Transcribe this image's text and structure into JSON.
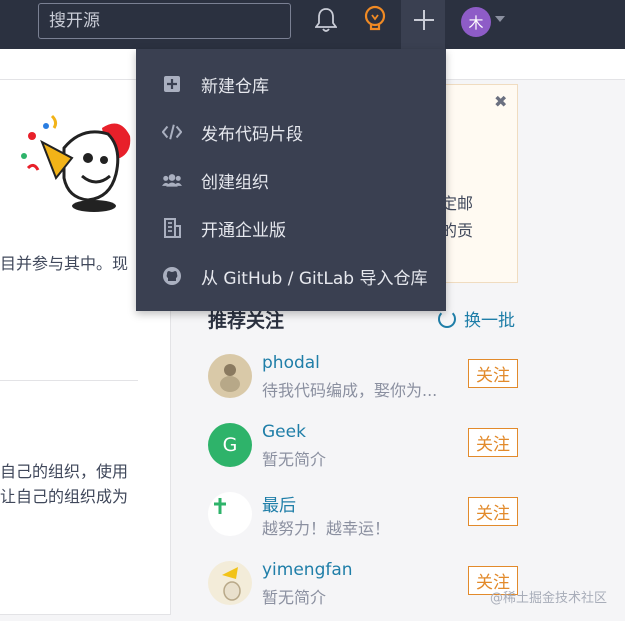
{
  "topbar": {
    "search_placeholder": "搜开源",
    "avatar_letter": "木"
  },
  "dropdown": {
    "items": [
      {
        "label": "新建仓库",
        "icon": "plus-square-icon"
      },
      {
        "label": "发布代码片段",
        "icon": "code-icon"
      },
      {
        "label": "创建组织",
        "icon": "users-icon"
      },
      {
        "label": "开通企业版",
        "icon": "building-icon"
      },
      {
        "label": "从 GitHub / GitLab 导入仓库",
        "icon": "github-icon"
      }
    ]
  },
  "left": {
    "line1": "目并参与其中。现",
    "line2": "自己的组织，使用",
    "line3": "让自己的组织成为"
  },
  "notice": {
    "line1": "绑定邮",
    "line2": "上的贡",
    "close": "✖"
  },
  "recommend": {
    "title": "推荐关注",
    "refresh_label": "换一批",
    "follow_label": "关注",
    "users": [
      {
        "name": "phodal",
        "bio": "待我代码编成，娶你为...",
        "avatar_letter": "",
        "avatar_color": "#d9c9a8"
      },
      {
        "name": "Geek",
        "bio": "暂无简介",
        "avatar_letter": "G",
        "avatar_color": "#2eb36a"
      },
      {
        "name": "最后",
        "bio": "越努力！越幸运！",
        "avatar_letter": "",
        "avatar_color": "#ffffff"
      },
      {
        "name": "yimengfan",
        "bio": "暂无简介",
        "avatar_letter": "",
        "avatar_color": "#f3ecd9"
      }
    ]
  },
  "watermark": "@稀土掘金技术社区",
  "colors": {
    "topbar": "#2b3140",
    "dropdown": "#3a4051",
    "accent_link": "#1f7ea8",
    "follow": "#e28a2b"
  }
}
